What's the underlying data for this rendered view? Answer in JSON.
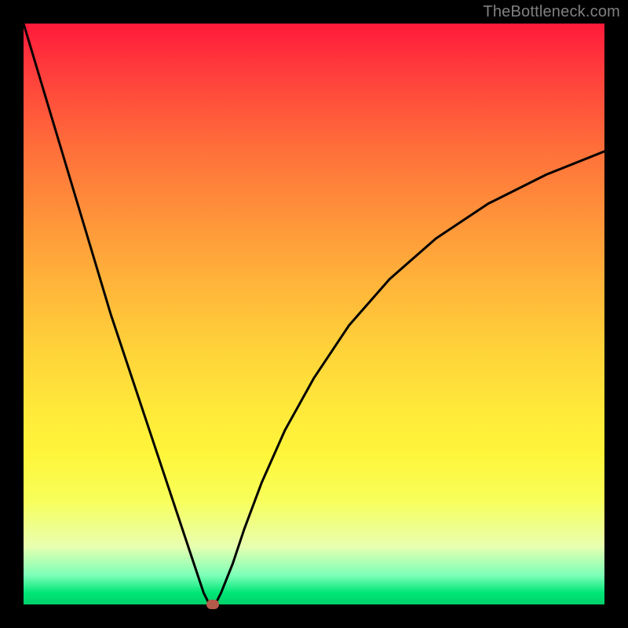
{
  "watermark": "TheBottleneck.com",
  "chart_data": {
    "type": "line",
    "title": "",
    "xlabel": "",
    "ylabel": "",
    "xlim": [
      0,
      100
    ],
    "ylim": [
      0,
      100
    ],
    "grid": false,
    "background_gradient": {
      "direction": "vertical",
      "stops": [
        {
          "pos": 0,
          "color": "#ff1a3a"
        },
        {
          "pos": 32,
          "color": "#ff8f3a"
        },
        {
          "pos": 66,
          "color": "#ffe83a"
        },
        {
          "pos": 95,
          "color": "#7cffb8"
        },
        {
          "pos": 100,
          "color": "#00d06a"
        }
      ]
    },
    "series": [
      {
        "name": "bottleneck-curve",
        "x": [
          0,
          3,
          6,
          9,
          12,
          15,
          18,
          21,
          24,
          27,
          30,
          31,
          32,
          33,
          34,
          36,
          38,
          41,
          45,
          50,
          56,
          63,
          71,
          80,
          90,
          100
        ],
        "y": [
          100,
          90,
          80,
          70,
          60,
          50,
          41,
          32,
          23,
          14,
          5,
          2,
          0,
          0,
          2,
          7,
          13,
          21,
          30,
          39,
          48,
          56,
          63,
          69,
          74,
          78
        ]
      }
    ],
    "marker": {
      "x": 32.5,
      "y": 0
    },
    "colors": {
      "curve": "#000000",
      "marker": "#b45a4a",
      "frame": "#000000"
    }
  }
}
